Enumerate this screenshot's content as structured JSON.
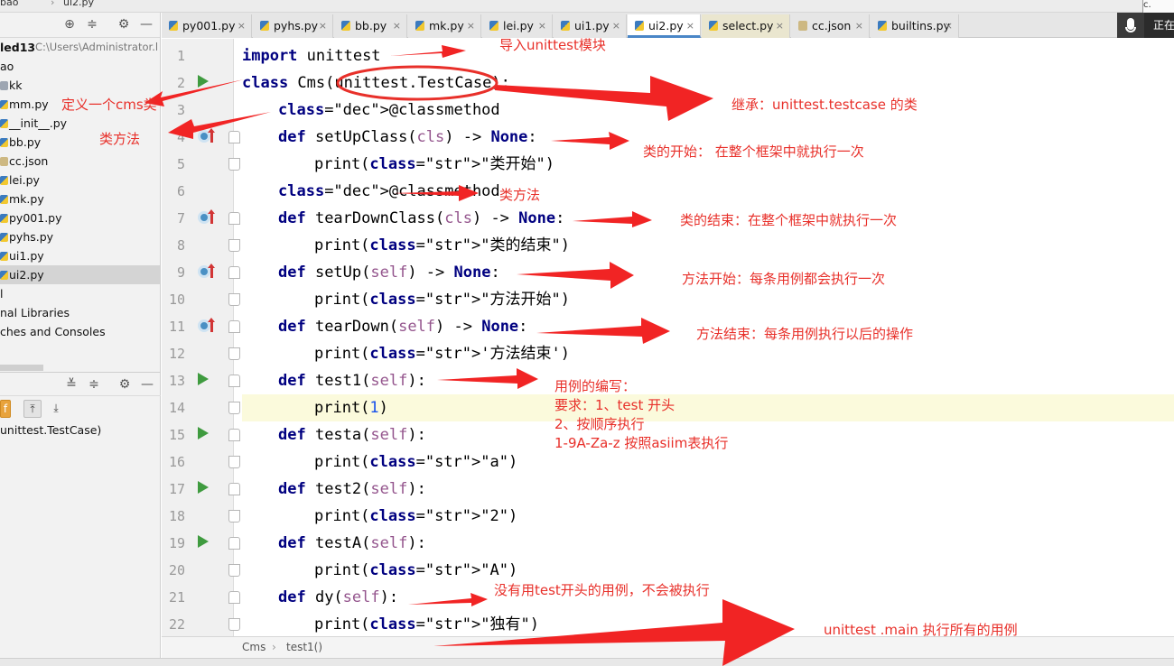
{
  "window": {
    "top_breadcrumb": [
      "bao",
      "ui2.py"
    ]
  },
  "project_panel": {
    "root_label": "led13",
    "root_path": "C:\\Users\\Administrator.l",
    "items": [
      {
        "label": "ao",
        "type": "folder"
      },
      {
        "label": "kk",
        "type": "folder"
      },
      {
        "label": "mm.py",
        "type": "py"
      },
      {
        "label": "__init__.py",
        "type": "py"
      },
      {
        "label": "bb.py",
        "type": "py"
      },
      {
        "label": "cc.json",
        "type": "json"
      },
      {
        "label": "lei.py",
        "type": "py"
      },
      {
        "label": "mk.py",
        "type": "py"
      },
      {
        "label": "py001.py",
        "type": "py"
      },
      {
        "label": "pyhs.py",
        "type": "py"
      },
      {
        "label": "ui1.py",
        "type": "py"
      },
      {
        "label": "ui2.py",
        "type": "py",
        "selected": true
      },
      {
        "label": "l",
        "type": "none"
      },
      {
        "label": "nal Libraries",
        "type": "none"
      },
      {
        "label": "ches and Consoles",
        "type": "none"
      }
    ]
  },
  "structure_panel": {
    "item_label": "unittest.TestCase)"
  },
  "tabs": [
    {
      "label": "py001.py",
      "icon": "python-file-icon",
      "active": false
    },
    {
      "label": "pyhs.py",
      "icon": "python-file-icon",
      "active": false
    },
    {
      "label": "bb.py",
      "icon": "python-file-icon",
      "active": false
    },
    {
      "label": "mk.py",
      "icon": "python-file-icon",
      "active": false
    },
    {
      "label": "lei.py",
      "icon": "python-file-icon",
      "active": false
    },
    {
      "label": "ui1.py",
      "icon": "python-file-icon",
      "active": false
    },
    {
      "label": "ui2.py",
      "icon": "python-file-icon",
      "active": true
    },
    {
      "label": "select.py",
      "icon": "python-file-icon",
      "active": false
    },
    {
      "label": "cc.json",
      "icon": "json-file-icon",
      "active": false
    },
    {
      "label": "builtins.py",
      "icon": "python-file-icon",
      "active": false
    }
  ],
  "overlay": {
    "status_text": "正在",
    "corner_text": "c."
  },
  "editor": {
    "line_numbers": [
      "1",
      "2",
      "3",
      "4",
      "5",
      "6",
      "7",
      "8",
      "9",
      "10",
      "11",
      "12",
      "13",
      "14",
      "15",
      "16",
      "17",
      "18",
      "19",
      "20",
      "21",
      "22"
    ],
    "lines": [
      "import unittest",
      "class Cms(unittest.TestCase):",
      "@classmethod",
      "def setUpClass(cls) -> None:",
      "print(\"类开始\")",
      "@classmethod",
      "def tearDownClass(cls) -> None:",
      "print(\"类的结束\")",
      "def setUp(self) -> None:",
      "print(\"方法开始\")",
      "def tearDown(self) -> None:",
      "print('方法结束')",
      "def test1(self):",
      "print(1)",
      "def testa(self):",
      "print(\"a\")",
      "def test2(self):",
      "print(\"2\")",
      "def testA(self):",
      "print(\"A\")",
      "def dy(self):",
      "print(\"独有\")"
    ],
    "current_line": "14"
  },
  "breadcrumb": [
    "Cms",
    "test1()"
  ],
  "annotations": {
    "n1": "导入unittest模块",
    "n2": "定义一个cms类",
    "n3": "继承：unittest.testcase 的类",
    "n4": "类方法",
    "n5": "类的开始：  在整个框架中就执行一次",
    "n6": "类方法",
    "n7": "类的结束：在整个框架中就执行一次",
    "n8": "方法开始：每条用例都会执行一次",
    "n9": "方法结束：每条用例执行以后的操作",
    "n10_lines": [
      "用例的编写：",
      "要求：1、test 开头",
      "2、按顺序执行",
      "1-9A-Za-z 按照asiim表执行"
    ],
    "n11": "没有用test开头的用例，不会被执行",
    "n12": "unittest .main   执行所有的用例"
  },
  "colors": {
    "annotation": "#e8302a",
    "keyword": "#000080",
    "string": "#067d17",
    "self": "#94558d",
    "decorator": "#3333bb",
    "run_icon": "#3f9b3f",
    "current_line_bg": "#fbfadc"
  }
}
